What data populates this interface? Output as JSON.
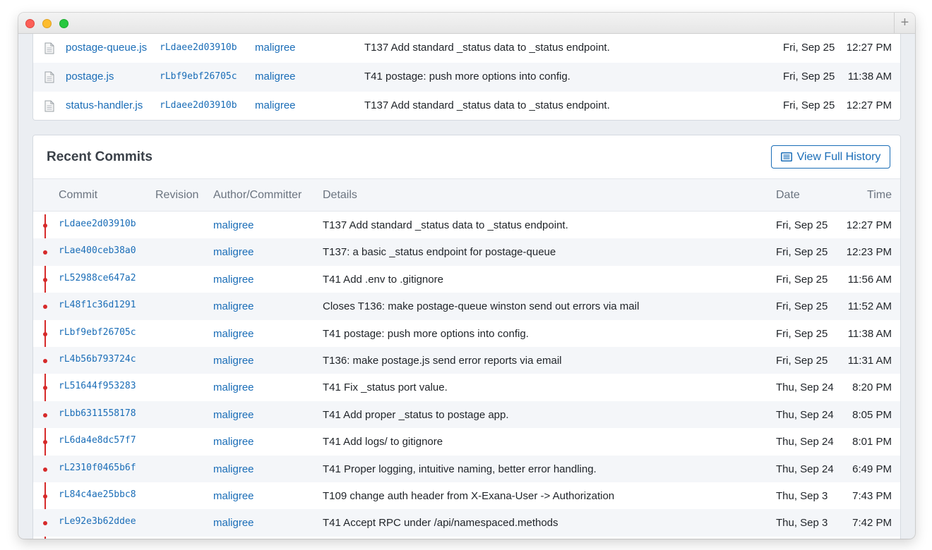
{
  "files": [
    {
      "name": "postage-queue.js",
      "commit": "rLdaee2d03910b",
      "author": "maligree",
      "details": "T137 Add standard _status data to _status endpoint.",
      "date": "Fri, Sep 25",
      "time": "12:27 PM"
    },
    {
      "name": "postage.js",
      "commit": "rLbf9ebf26705c",
      "author": "maligree",
      "details": "T41 postage: push more options into config.",
      "date": "Fri, Sep 25",
      "time": "11:38 AM"
    },
    {
      "name": "status-handler.js",
      "commit": "rLdaee2d03910b",
      "author": "maligree",
      "details": "T137 Add standard _status data to _status endpoint.",
      "date": "Fri, Sep 25",
      "time": "12:27 PM"
    }
  ],
  "recent": {
    "title": "Recent Commits",
    "history_button": "View Full History",
    "headers": {
      "commit": "Commit",
      "revision": "Revision",
      "author": "Author/Committer",
      "details": "Details",
      "date": "Date",
      "time": "Time"
    },
    "rows": [
      {
        "commit": "rLdaee2d03910b",
        "author": "maligree",
        "details": "T137 Add standard _status data to _status endpoint.",
        "date": "Fri, Sep 25",
        "time": "12:27 PM"
      },
      {
        "commit": "rLae400ceb38a0",
        "author": "maligree",
        "details": "T137: a basic _status endpoint for postage-queue",
        "date": "Fri, Sep 25",
        "time": "12:23 PM"
      },
      {
        "commit": "rL52988ce647a2",
        "author": "maligree",
        "details": "T41 Add .env to .gitignore",
        "date": "Fri, Sep 25",
        "time": "11:56 AM"
      },
      {
        "commit": "rL48f1c36d1291",
        "author": "maligree",
        "details": "Closes T136: make postage-queue winston send out errors via mail",
        "date": "Fri, Sep 25",
        "time": "11:52 AM"
      },
      {
        "commit": "rLbf9ebf26705c",
        "author": "maligree",
        "details": "T41 postage: push more options into config.",
        "date": "Fri, Sep 25",
        "time": "11:38 AM"
      },
      {
        "commit": "rL4b56b793724c",
        "author": "maligree",
        "details": "T136: make postage.js send error reports via email",
        "date": "Fri, Sep 25",
        "time": "11:31 AM"
      },
      {
        "commit": "rL51644f953283",
        "author": "maligree",
        "details": "T41 Fix _status port value.",
        "date": "Thu, Sep 24",
        "time": "8:20 PM"
      },
      {
        "commit": "rLbb6311558178",
        "author": "maligree",
        "details": "T41 Add proper _status to postage app.",
        "date": "Thu, Sep 24",
        "time": "8:05 PM"
      },
      {
        "commit": "rL6da4e8dc57f7",
        "author": "maligree",
        "details": "T41 Add logs/ to gitignore",
        "date": "Thu, Sep 24",
        "time": "8:01 PM"
      },
      {
        "commit": "rL2310f0465b6f",
        "author": "maligree",
        "details": "T41 Proper logging, intuitive naming, better error handling.",
        "date": "Thu, Sep 24",
        "time": "6:49 PM"
      },
      {
        "commit": "rL84c4ae25bbc8",
        "author": "maligree",
        "details": "T109 change auth header from X-Exana-User -> Authorization",
        "date": "Thu, Sep 3",
        "time": "7:43 PM"
      },
      {
        "commit": "rLe92e3b62ddee",
        "author": "maligree",
        "details": "T41 Accept RPC under /api/namespaced.methods",
        "date": "Thu, Sep 3",
        "time": "7:42 PM"
      }
    ]
  }
}
